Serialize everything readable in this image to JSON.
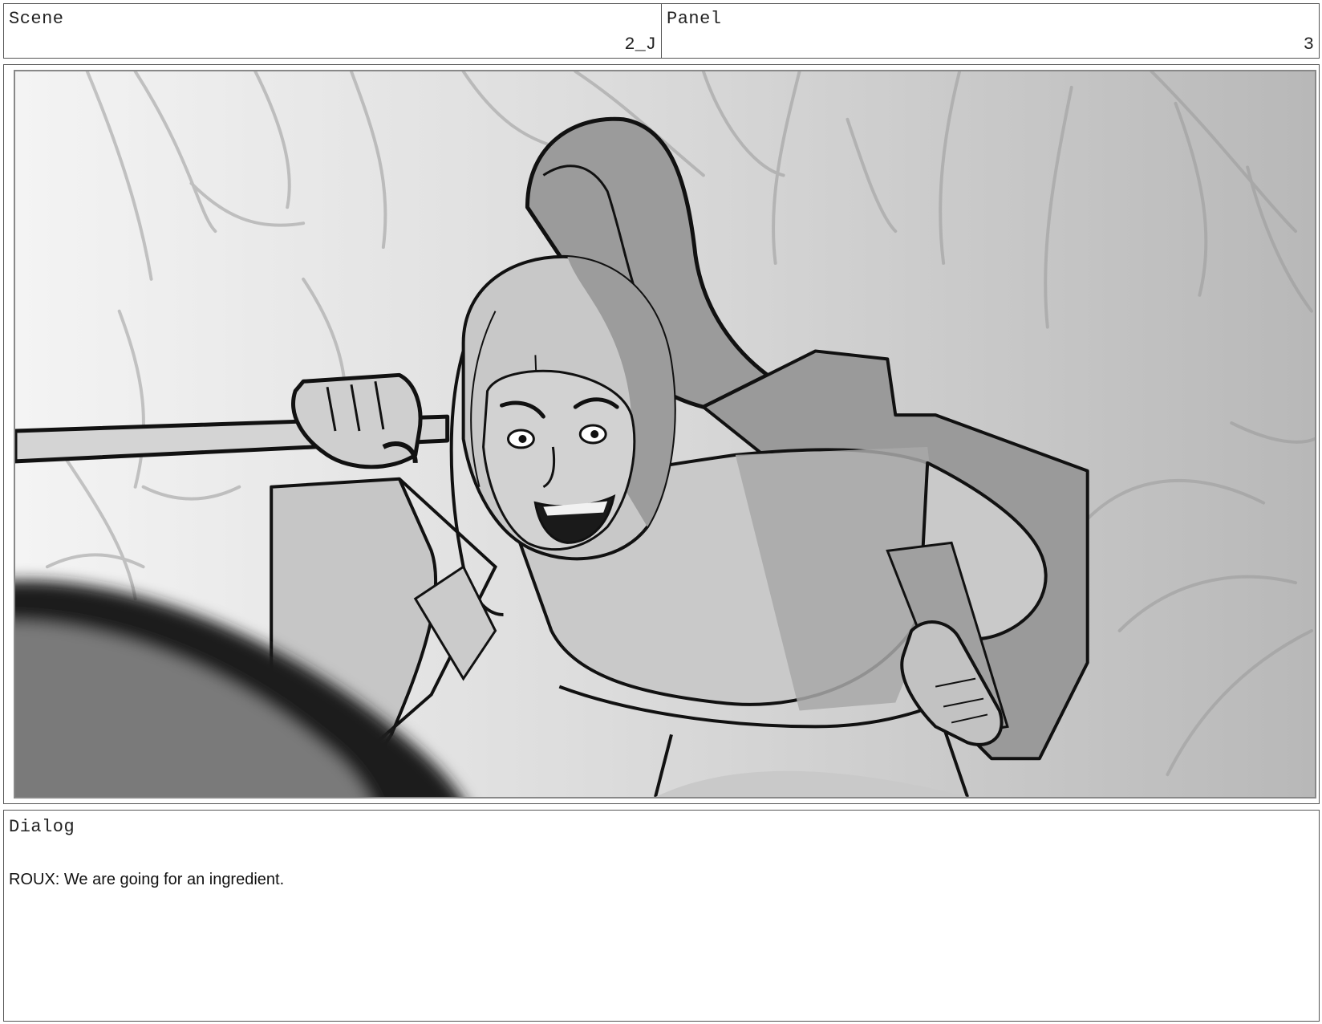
{
  "header": {
    "scene_label": "Scene",
    "scene_value": "2_J",
    "panel_label": "Panel",
    "panel_value": "3"
  },
  "dialog": {
    "label": "Dialog",
    "text": "ROUX: We are going for an ingredient."
  }
}
